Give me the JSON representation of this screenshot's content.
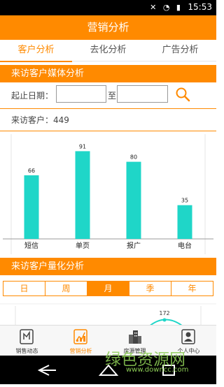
{
  "status": {
    "time": "15:53"
  },
  "title": "营销分析",
  "tabs": [
    {
      "label": "客户分析",
      "active": true
    },
    {
      "label": "去化分析",
      "active": false
    },
    {
      "label": "广告分析",
      "active": false
    }
  ],
  "media_section": {
    "title": "来访客户媒体分析",
    "date_label": "起止日期：",
    "date_start": "",
    "date_to_label": "至",
    "date_end": "",
    "visitors_label": "来访客户：",
    "visitors_count": "449"
  },
  "chart_data": {
    "type": "bar",
    "categories": [
      "短信",
      "单页",
      "报广",
      "电台"
    ],
    "values": [
      66,
      91,
      80,
      35
    ],
    "color": "#1fd6c8",
    "ylim": [
      0,
      100
    ]
  },
  "quant_section": {
    "title": "来访客户量化分析",
    "periods": [
      "日",
      "周",
      "月",
      "季",
      "年"
    ],
    "active_period": "月",
    "partial_label": "172"
  },
  "bottom_nav": [
    {
      "label": "销售动态",
      "icon": "sales-trend-icon",
      "active": false
    },
    {
      "label": "营销分析",
      "icon": "marketing-chart-icon",
      "active": true
    },
    {
      "label": "房源管理",
      "icon": "building-icon",
      "active": false
    },
    {
      "label": "个人中心",
      "icon": "person-icon",
      "active": false
    }
  ],
  "watermark": {
    "text": "绿色资源网",
    "url": "www.downcc.com"
  },
  "colors": {
    "accent": "#ff8a00",
    "bar": "#1fd6c8"
  }
}
